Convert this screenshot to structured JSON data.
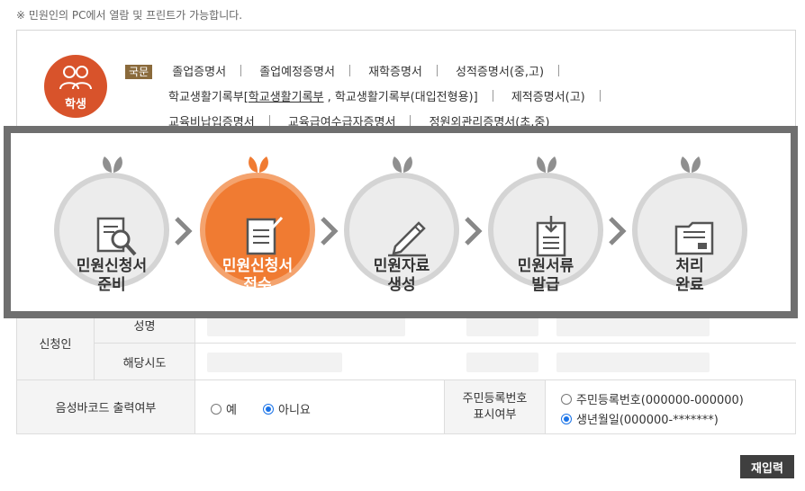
{
  "notice": "※ 민원인의 PC에서 열람 및 프린트가 가능합니다.",
  "badge": {
    "label": "학생"
  },
  "certificates": {
    "category": "국문",
    "row1": [
      "졸업증명서",
      "졸업예정증명서",
      "재학증명서",
      "성적증명서(중,고)"
    ],
    "row2_prefix": "학교생활기록부[",
    "row2_underlined": "학교생활기록부",
    "row2_mid": ", 학교생활기록부(대입전형용)]",
    "row2_last": "제적증명서(고)",
    "row3": [
      "교육비납입증명서",
      "교육급여수급자증명서",
      "정원외관리증명서(초,중)"
    ]
  },
  "process": {
    "steps": [
      {
        "line1": "민원신청서",
        "line2": "준비",
        "icon": "document-search-icon",
        "active": false
      },
      {
        "line1": "민원신청서",
        "line2": "접수",
        "icon": "document-check-icon",
        "active": true
      },
      {
        "line1": "민원자료",
        "line2": "생성",
        "icon": "pencil-line-icon",
        "active": false
      },
      {
        "line1": "민원서류",
        "line2": "발급",
        "icon": "clipboard-download-icon",
        "active": false
      },
      {
        "line1": "처리",
        "line2": "완료",
        "icon": "folder-complete-icon",
        "active": false
      }
    ]
  },
  "form": {
    "applicant": "신청인",
    "name_label": "성명",
    "region_label": "해당시도",
    "barcode_label": "음성바코드 출력여부",
    "barcode_yes": "예",
    "barcode_no": "아니요",
    "barcode_selected": "아니요",
    "rrn_label_line1": "주민등록번호",
    "rrn_label_line2": "표시여부",
    "rrn_opt1": "주민등록번호(000000-000000)",
    "rrn_opt2": "생년월일(000000-*******)",
    "rrn_selected": "생년월일(000000-*******)"
  },
  "buttons": {
    "reset": "재입력"
  },
  "colors": {
    "accent": "#f07b32",
    "badge": "#d8532b",
    "overlay_border": "#6f6f6f",
    "radio": "#1a73e8"
  }
}
